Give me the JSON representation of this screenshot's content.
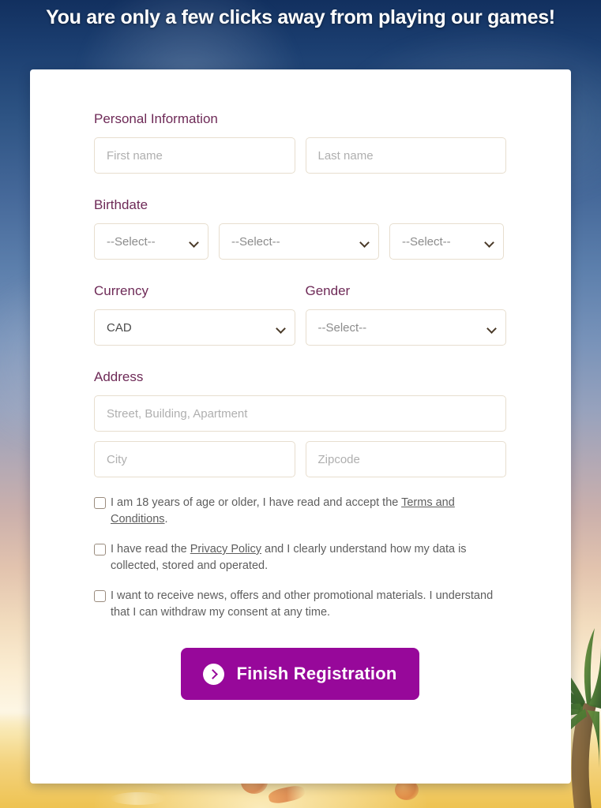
{
  "page": {
    "title": "You are only a few clicks away from playing our games!"
  },
  "form": {
    "sections": {
      "personal_information": "Personal Information",
      "birthdate": "Birthdate",
      "currency": "Currency",
      "gender": "Gender",
      "address": "Address"
    },
    "fields": {
      "first_name": {
        "value": "",
        "placeholder": "First name"
      },
      "last_name": {
        "value": "",
        "placeholder": "Last name"
      },
      "birth_day": {
        "value": "--Select--"
      },
      "birth_month": {
        "value": "--Select--"
      },
      "birth_year": {
        "value": "--Select--"
      },
      "currency": {
        "value": "CAD"
      },
      "gender": {
        "value": "--Select--"
      },
      "street": {
        "value": "",
        "placeholder": "Street, Building, Apartment"
      },
      "city": {
        "value": "",
        "placeholder": "City"
      },
      "zipcode": {
        "value": "",
        "placeholder": "Zipcode"
      }
    },
    "consents": [
      {
        "text_before": "I am 18 years of age or older, I have read and accept the ",
        "link": "Terms and Conditions",
        "text_after": ".",
        "checked": false
      },
      {
        "text_before": "I have read the ",
        "link": "Privacy Policy",
        "text_after": " and I clearly understand how my data is collected, stored and operated.",
        "checked": false
      },
      {
        "text_before": "I want to receive news, offers and other promotional materials. I understand that I can withdraw my consent at any time.",
        "link": "",
        "text_after": "",
        "checked": false
      }
    ],
    "submit": {
      "label": "Finish Registration",
      "icon": "chevron-right-circle-icon"
    }
  },
  "colors": {
    "accent": "#97089A",
    "heading": "#6E2A57",
    "input_border": "#E7DECF",
    "placeholder": "#AFAFAF",
    "body_text": "#5E5E5E",
    "card_background": "#FFFFFF",
    "title_text": "#FFFFFF"
  }
}
